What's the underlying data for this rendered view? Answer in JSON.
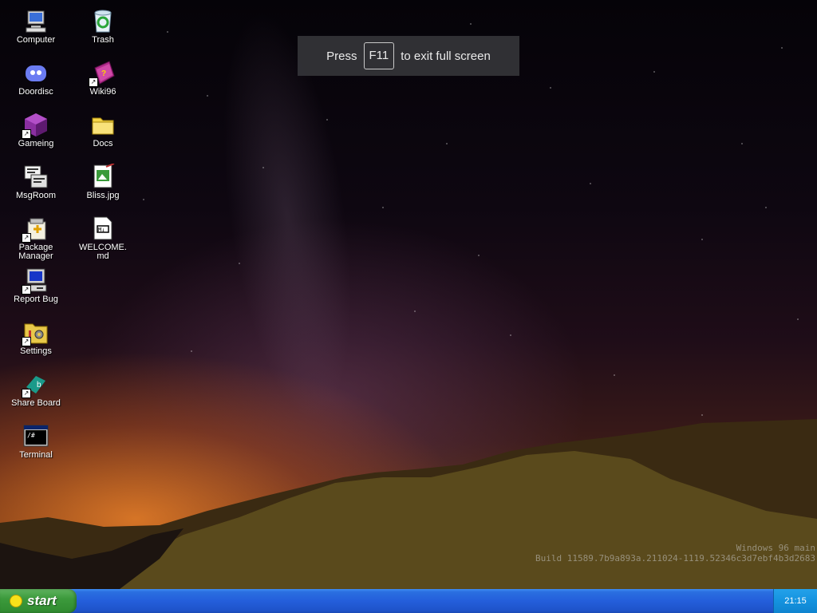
{
  "fullscreen_toast": {
    "press": "Press",
    "key": "F11",
    "rest": "to exit full screen"
  },
  "desktop_icons": [
    {
      "label": "Computer",
      "icon": "computer-icon"
    },
    {
      "label": "Doordisc",
      "icon": "doordisc-icon"
    },
    {
      "label": "Gameing",
      "icon": "gameing-icon"
    },
    {
      "label": "MsgRoom",
      "icon": "msgroom-icon"
    },
    {
      "label": "Package Manager",
      "icon": "package-manager-icon"
    },
    {
      "label": "Report Bug",
      "icon": "report-bug-icon"
    },
    {
      "label": "Settings",
      "icon": "settings-icon"
    },
    {
      "label": "Share Board",
      "icon": "share-board-icon"
    },
    {
      "label": "Terminal",
      "icon": "terminal-icon"
    },
    {
      "label": "Trash",
      "icon": "trash-icon"
    },
    {
      "label": "Wiki96",
      "icon": "wiki96-icon"
    },
    {
      "label": "Docs",
      "icon": "folder-icon"
    },
    {
      "label": "Bliss.jpg",
      "icon": "image-file-icon"
    },
    {
      "label": "WELCOME.md",
      "icon": "markdown-file-icon"
    }
  ],
  "build_info": {
    "line1": "Windows 96 main",
    "line2": "Build 11589.7b9a893a.211024-1119.52346c3d7ebf4b3d2683"
  },
  "taskbar": {
    "start_label": "start",
    "clock": "21:15"
  },
  "colors": {
    "taskbar_blue": "#245edb",
    "start_green": "#3c9a3c",
    "tray_blue": "#1493df"
  }
}
